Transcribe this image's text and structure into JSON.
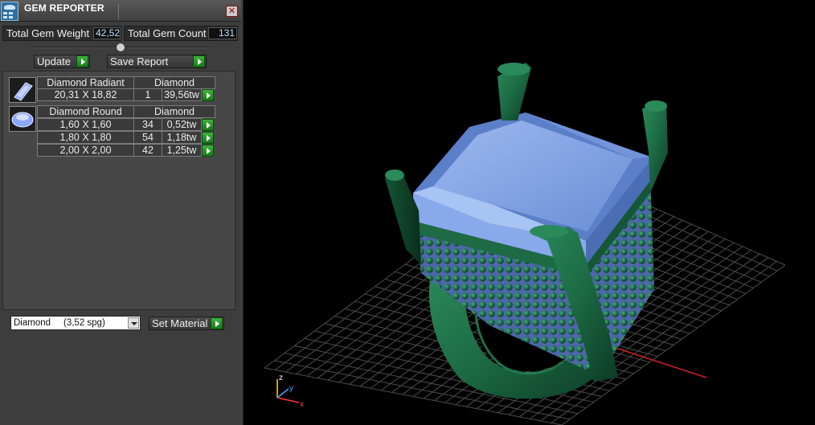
{
  "window": {
    "title": "GEM REPORTER",
    "close_glyph": "✕"
  },
  "totals": {
    "weight_label": "Total Gem Weight",
    "weight_value": "42,52",
    "count_label": "Total Gem Count",
    "count_value": "131"
  },
  "toolbar": {
    "update_label": "Update",
    "save_report_label": "Save Report"
  },
  "gem_groups": [
    {
      "name": "Diamond Radiant",
      "material": "Diamond",
      "thumb_icon": "radiant-cut-icon",
      "rows": [
        {
          "size": "20,31 X 18,82",
          "count": "1",
          "weight": "39,56tw"
        }
      ]
    },
    {
      "name": "Diamond Round",
      "material": "Diamond",
      "thumb_icon": "round-cut-icon",
      "rows": [
        {
          "size": "1,60 X 1,60",
          "count": "34",
          "weight": "0,52tw"
        },
        {
          "size": "1,80 X 1,80",
          "count": "54",
          "weight": "1,18tw"
        },
        {
          "size": "2,00 X 2,00",
          "count": "42",
          "weight": "1,25tw"
        }
      ]
    }
  ],
  "material": {
    "selected": "Diamond     (3,52 spg)",
    "set_label": "Set Material"
  },
  "viewport": {
    "axes": {
      "x": "x",
      "y": "y",
      "z": "z"
    },
    "colors": {
      "metal": "#1f6a45",
      "gem": "#7fa4e0",
      "grid": "#5a5a5a",
      "axis_x": "#cc2020"
    }
  }
}
